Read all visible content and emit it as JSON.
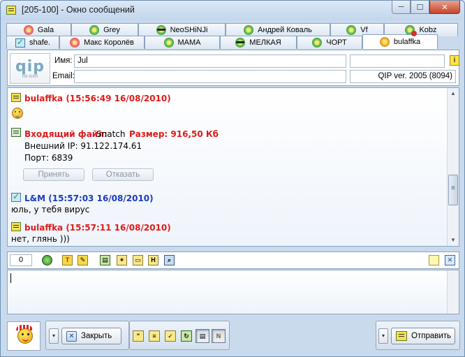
{
  "window": {
    "title": "[205-100] - Окно сообщений",
    "min": "─",
    "max": "☐",
    "close": "✕"
  },
  "tabs": {
    "row1": [
      {
        "label": "Gala",
        "icon": "flower-red-icon"
      },
      {
        "label": "Grey",
        "icon": "flower-green-icon"
      },
      {
        "label": "NeoSHiNJi",
        "icon": "flower-glasses-icon"
      },
      {
        "label": "Андрей Коваль",
        "icon": "flower-green-icon"
      },
      {
        "label": "Vf",
        "icon": "flower-green-icon"
      },
      {
        "label": "Kobz",
        "icon": "flower-dnd-icon"
      }
    ],
    "row2": [
      {
        "label": "shafe.",
        "icon": "message-icon"
      },
      {
        "label": "Макс Королёв",
        "icon": "flower-red-icon"
      },
      {
        "label": "MAMA",
        "icon": "flower-green-icon"
      },
      {
        "label": "МЕЛКАЯ",
        "icon": "flower-glasses-icon"
      },
      {
        "label": "ЧОРТ",
        "icon": "flower-green-icon"
      },
      {
        "label": "bulaffka",
        "icon": "flower-sun-icon",
        "active": true
      }
    ]
  },
  "info": {
    "logo_big": "qip",
    "logo_small": "no icon",
    "name_label": "Имя:",
    "name_value": "Jul",
    "email_label": "Email:",
    "email_value": "",
    "version": "QIP ver. 2005 (8094)",
    "info_icon_glyph": "i"
  },
  "history": {
    "messages": [
      {
        "header": "bulaffka (15:56:49 16/08/2010)",
        "color": "#e01a1a"
      }
    ],
    "file": {
      "label": "Входящий файл:",
      "name": "Snatch",
      "size": "Размер: 916,50 Кб",
      "ip": "Внешний IP: 91.122.174.61",
      "port": "Порт: 6839",
      "accept": "Принять",
      "decline": "Отказать"
    },
    "msg2": {
      "header": "L&M (15:57:03 16/08/2010)",
      "text": "юль, у тебя вирус"
    },
    "msg3": {
      "header": "bulaffka (15:57:11 16/08/2010)",
      "text": "нет, глянь )))"
    }
  },
  "toolbar": {
    "counter": "0"
  },
  "bottom": {
    "close_label": "Закрыть",
    "send_label": "Отправить",
    "close_x": "✕",
    "dd_arrow": "▾"
  }
}
